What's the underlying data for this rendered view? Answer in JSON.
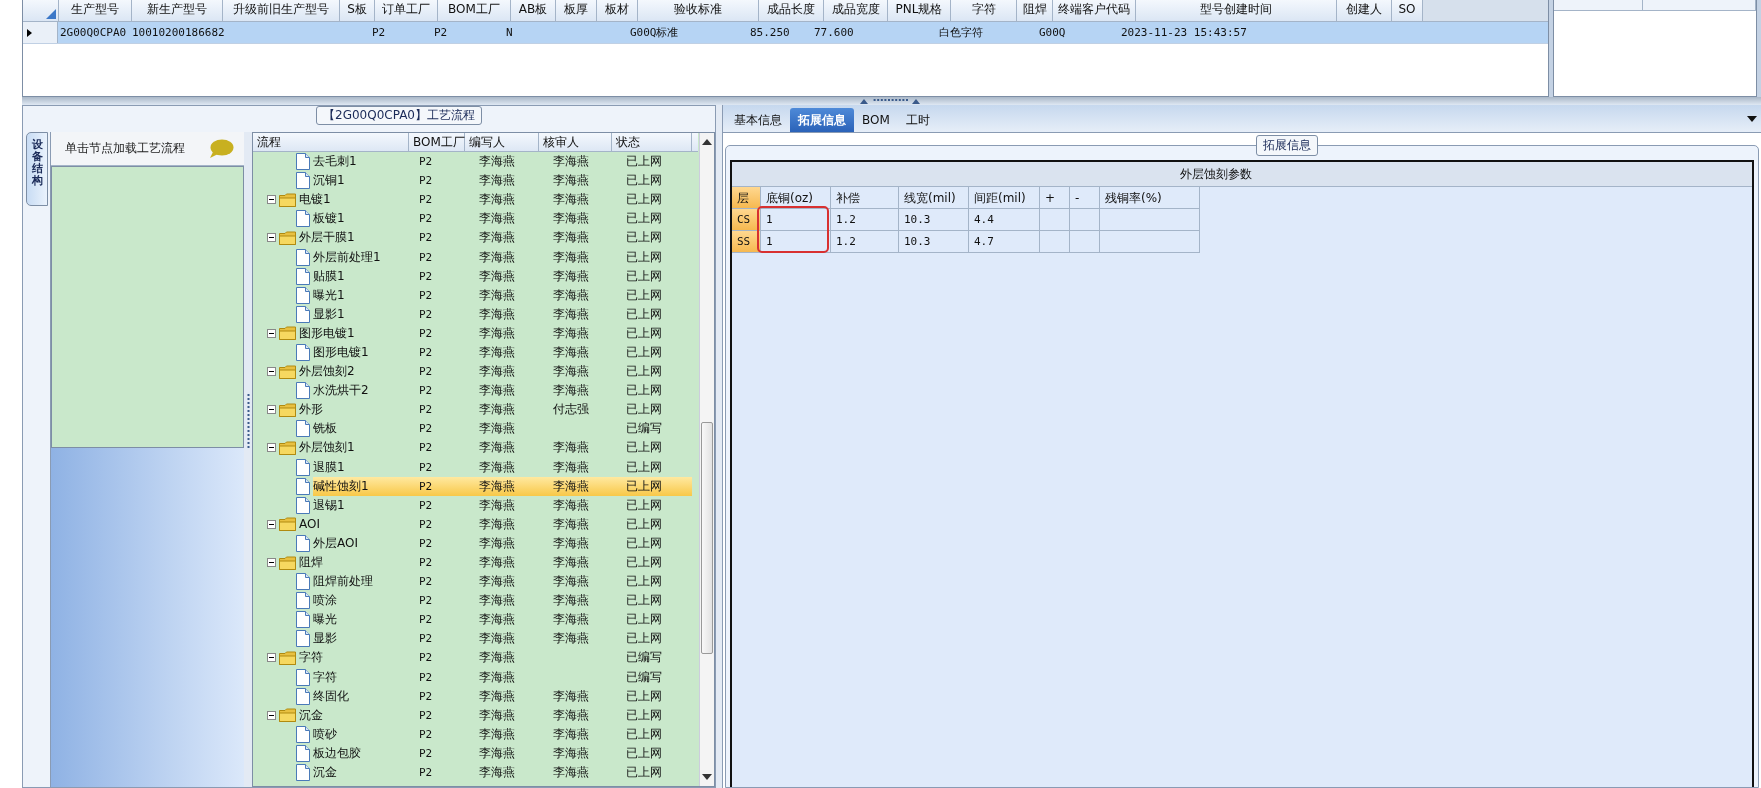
{
  "product_grid": {
    "columns": [
      "生产型号",
      "新生产型号",
      "升级前旧生产型号",
      "S板",
      "订单工厂",
      "BOM工厂",
      "AB板",
      "板厚",
      "板材",
      "验收标准",
      "成品长度",
      "成品宽度",
      "PNL规格",
      "字符",
      "阻焊",
      "终端客户代码",
      "型号创建时间",
      "创建人",
      "SO"
    ],
    "rows": [
      {
        "selected": true,
        "cells": [
          "2G00Q0CPA0",
          "10010200186682",
          "",
          "",
          "P2",
          "P2",
          "N",
          "",
          "",
          "G00Q标准",
          "85.250",
          "77.600",
          "",
          "白色字符",
          "",
          "G00Q",
          "2023-11-23 15:43:57",
          "",
          ""
        ]
      }
    ]
  },
  "left_panel": {
    "group_title": "【2G00Q0CPA0】工艺流程",
    "side_tab": "设备结构",
    "hint": "单击节点加载工艺流程",
    "tree": {
      "columns": [
        "流程",
        "BOM工厂",
        "编写人",
        "核审人",
        "状态"
      ],
      "rows": [
        {
          "children": [
            {
              "name": "去毛刺1",
              "bom": "P2",
              "author": "李海燕",
              "reviewer": "李海燕",
              "status": "已上网",
              "selected": false
            },
            {
              "name": "沉铜1",
              "bom": "P2",
              "author": "李海燕",
              "reviewer": "李海燕",
              "status": "已上网",
              "selected": false
            }
          ]
        },
        {
          "name": "电镀1",
          "bom": "P2",
          "author": "李海燕",
          "reviewer": "李海燕",
          "status": "已上网",
          "selected": false,
          "expanded": true,
          "children": [
            {
              "name": "板镀1",
              "bom": "P2",
              "author": "李海燕",
              "reviewer": "李海燕",
              "status": "已上网",
              "selected": false
            }
          ]
        },
        {
          "name": "外层干膜1",
          "bom": "P2",
          "author": "李海燕",
          "reviewer": "李海燕",
          "status": "已上网",
          "selected": false,
          "expanded": true,
          "children": [
            {
              "name": "外层前处理1",
              "bom": "P2",
              "author": "李海燕",
              "reviewer": "李海燕",
              "status": "已上网",
              "selected": false
            },
            {
              "name": "贴膜1",
              "bom": "P2",
              "author": "李海燕",
              "reviewer": "李海燕",
              "status": "已上网",
              "selected": false
            },
            {
              "name": "曝光1",
              "bom": "P2",
              "author": "李海燕",
              "reviewer": "李海燕",
              "status": "已上网",
              "selected": false
            },
            {
              "name": "显影1",
              "bom": "P2",
              "author": "李海燕",
              "reviewer": "李海燕",
              "status": "已上网",
              "selected": false
            }
          ]
        },
        {
          "name": "图形电镀1",
          "bom": "P2",
          "author": "李海燕",
          "reviewer": "李海燕",
          "status": "已上网",
          "selected": false,
          "expanded": true,
          "children": [
            {
              "name": "图形电镀1",
              "bom": "P2",
              "author": "李海燕",
              "reviewer": "李海燕",
              "status": "已上网",
              "selected": false
            }
          ]
        },
        {
          "name": "外层蚀刻2",
          "bom": "P2",
          "author": "李海燕",
          "reviewer": "李海燕",
          "status": "已上网",
          "selected": false,
          "expanded": true,
          "children": [
            {
              "name": "水洗烘干2",
              "bom": "P2",
              "author": "李海燕",
              "reviewer": "李海燕",
              "status": "已上网",
              "selected": false
            }
          ]
        },
        {
          "name": "外形",
          "bom": "P2",
          "author": "李海燕",
          "reviewer": "付志强",
          "status": "已上网",
          "selected": false,
          "expanded": true,
          "children": [
            {
              "name": "铣板",
              "bom": "P2",
              "author": "李海燕",
              "status": "已编写",
              "selected": false
            }
          ]
        },
        {
          "name": "外层蚀刻1",
          "bom": "P2",
          "author": "李海燕",
          "reviewer": "李海燕",
          "status": "已上网",
          "selected": false,
          "expanded": true,
          "children": [
            {
              "name": "退膜1",
              "bom": "P2",
              "author": "李海燕",
              "reviewer": "李海燕",
              "status": "已上网",
              "selected": false
            },
            {
              "name": "碱性蚀刻1",
              "bom": "P2",
              "author": "李海燕",
              "reviewer": "李海燕",
              "status": "已上网",
              "selected": true
            },
            {
              "name": "退锡1",
              "bom": "P2",
              "author": "李海燕",
              "reviewer": "李海燕",
              "status": "已上网",
              "selected": false
            }
          ]
        },
        {
          "name": "AOI",
          "bom": "P2",
          "author": "李海燕",
          "reviewer": "李海燕",
          "status": "已上网",
          "selected": false,
          "expanded": true,
          "children": [
            {
              "name": "外层AOI",
              "bom": "P2",
              "author": "李海燕",
              "reviewer": "李海燕",
              "status": "已上网",
              "selected": false
            }
          ]
        },
        {
          "name": "阻焊",
          "bom": "P2",
          "author": "李海燕",
          "reviewer": "李海燕",
          "status": "已上网",
          "selected": false,
          "expanded": true,
          "children": [
            {
              "name": "阻焊前处理",
              "bom": "P2",
              "author": "李海燕",
              "reviewer": "李海燕",
              "status": "已上网",
              "selected": false
            },
            {
              "name": "喷涂",
              "bom": "P2",
              "author": "李海燕",
              "reviewer": "李海燕",
              "status": "已上网",
              "selected": false
            },
            {
              "name": "曝光",
              "bom": "P2",
              "author": "李海燕",
              "reviewer": "李海燕",
              "status": "已上网",
              "selected": false
            },
            {
              "name": "显影",
              "bom": "P2",
              "author": "李海燕",
              "reviewer": "李海燕",
              "status": "已上网",
              "selected": false
            }
          ]
        },
        {
          "name": "字符",
          "bom": "P2",
          "author": "李海燕",
          "status": "已编写",
          "selected": false,
          "expanded": true,
          "children": [
            {
              "name": "字符",
              "bom": "P2",
              "author": "李海燕",
              "status": "已编写",
              "selected": false
            },
            {
              "name": "终固化",
              "bom": "P2",
              "author": "李海燕",
              "reviewer": "李海燕",
              "status": "已上网",
              "selected": false
            }
          ]
        },
        {
          "name": "沉金",
          "bom": "P2",
          "author": "李海燕",
          "reviewer": "李海燕",
          "status": "已上网",
          "selected": false,
          "expanded": true,
          "children": [
            {
              "name": "喷砂",
              "bom": "P2",
              "author": "李海燕",
              "reviewer": "李海燕",
              "status": "已上网",
              "selected": false
            },
            {
              "name": "板边包胶",
              "bom": "P2",
              "author": "李海燕",
              "reviewer": "李海燕",
              "status": "已上网",
              "selected": false
            },
            {
              "name": "沉金",
              "bom": "P2",
              "author": "李海燕",
              "reviewer": "李海燕",
              "status": "已上网",
              "selected": false
            }
          ]
        }
      ]
    }
  },
  "right_panel": {
    "tabs": [
      {
        "label": "基本信息",
        "selected": false
      },
      {
        "label": "拓展信息",
        "selected": true
      },
      {
        "label": "BOM",
        "selected": false
      },
      {
        "label": "工时",
        "selected": false
      }
    ],
    "group_title": "拓展信息",
    "param_table": {
      "title": "外层蚀刻参数",
      "columns": [
        {
          "label": "层",
          "highlighted": false
        },
        {
          "label": "底铜(oz)",
          "highlighted": true
        },
        {
          "label": "补偿",
          "highlighted": false
        },
        {
          "label": "线宽(mil)",
          "highlighted": false
        },
        {
          "label": "间距(mil)",
          "highlighted": false
        },
        {
          "label": "+",
          "highlighted": false
        },
        {
          "label": "-",
          "highlighted": false
        },
        {
          "label": "残铜率(%)",
          "highlighted": false
        }
      ],
      "rows": [
        [
          "CS",
          "1",
          "1.2",
          "10.3",
          "4.4",
          "",
          "",
          ""
        ],
        [
          "SS",
          "1",
          "1.2",
          "10.3",
          "4.7",
          "",
          "",
          ""
        ]
      ]
    }
  }
}
